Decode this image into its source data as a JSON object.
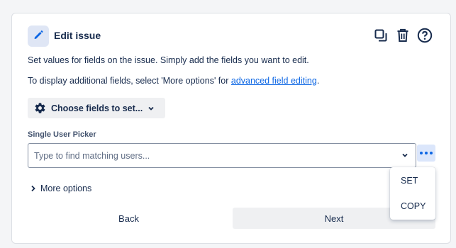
{
  "header": {
    "title": "Edit issue",
    "icons": [
      "pencil-icon",
      "copy-icon",
      "trash-icon",
      "help-icon"
    ],
    "accent_badge_bg": "#dfe6f5",
    "accent_icon_color": "#0c66e4"
  },
  "body": {
    "intro": "Set values for fields on the issue. Simply add the fields you want to edit.",
    "more_info_prefix": "To display additional fields, select 'More options' for ",
    "more_info_link": "advanced field editing",
    "more_info_suffix": "."
  },
  "choose_fields": {
    "label": "Choose fields to set...",
    "icon": "gear-icon"
  },
  "field": {
    "label": "Single User Picker",
    "placeholder": "Type to find matching users...",
    "value": ""
  },
  "more_options": {
    "label": "More options"
  },
  "footer": {
    "back_label": "Back",
    "next_label": "Next"
  },
  "dropdown": {
    "items": [
      {
        "label": "SET"
      },
      {
        "label": "COPY"
      }
    ]
  }
}
